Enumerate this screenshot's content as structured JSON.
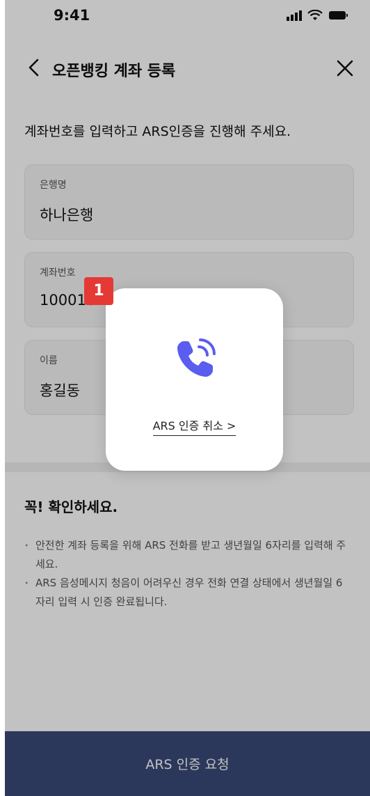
{
  "status_bar": {
    "time": "9:41"
  },
  "header": {
    "title": "오픈뱅킹 계좌 등록"
  },
  "description": "계좌번호를 입력하고 ARS인증을 진행해 주세요.",
  "fields": {
    "bank": {
      "label": "은행명",
      "value": "하나은행"
    },
    "account": {
      "label": "계좌번호",
      "value": "1000164"
    },
    "name": {
      "label": "이름",
      "value": "홍길동"
    }
  },
  "notice": {
    "title": "꼭! 확인하세요.",
    "items": [
      "안전한 계좌 등록을 위해 ARS 전화를 받고 생년월일 6자리를 입력해 주세요.",
      "ARS 음성메시지 청음이 어려우신 경우 전화 연결 상태에서 생년월일 6자리 입력 시 인증 완료됩니다."
    ]
  },
  "bottom_button": {
    "label": "ARS 인증 요청"
  },
  "popup": {
    "cancel_label": "ARS 인증 취소 >"
  },
  "marker": {
    "number": "1"
  },
  "colors": {
    "primary_button": "#3a4a78",
    "phone_icon": "#5b5cf0",
    "marker": "#e53935"
  }
}
